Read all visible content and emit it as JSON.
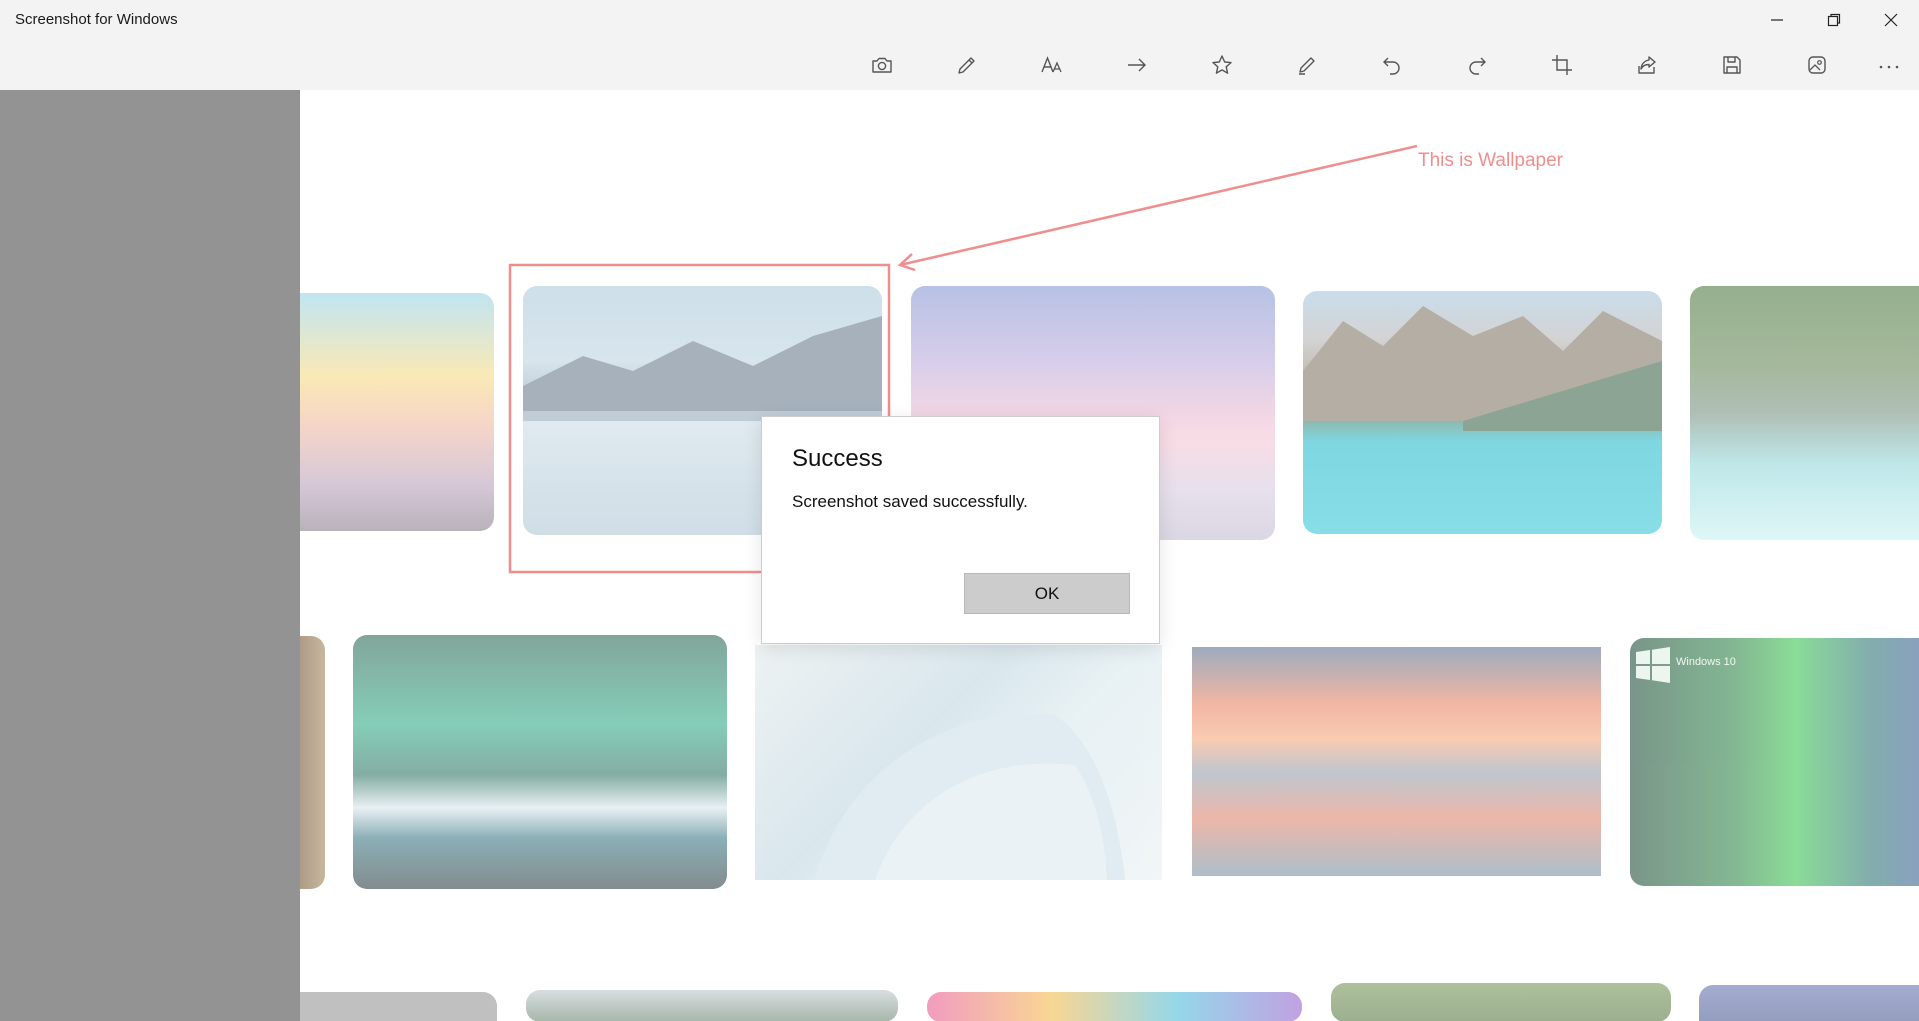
{
  "window": {
    "title": "Screenshot for Windows",
    "controls": [
      "minimize-icon",
      "restore-icon",
      "close-icon"
    ]
  },
  "toolbar": {
    "tools": [
      {
        "name": "camera-icon"
      },
      {
        "name": "pen-icon"
      },
      {
        "name": "text-size-icon"
      },
      {
        "name": "arrow-right-icon"
      },
      {
        "name": "star-icon"
      },
      {
        "name": "highlighter-icon"
      },
      {
        "name": "undo-icon"
      },
      {
        "name": "redo-icon"
      },
      {
        "name": "crop-icon"
      },
      {
        "name": "share-icon"
      },
      {
        "name": "save-icon"
      },
      {
        "name": "image-icon"
      },
      {
        "name": "more-icon"
      }
    ]
  },
  "annotation": {
    "label": "This is Wallpaper",
    "color": "#f08e8e"
  },
  "thumbnails": {
    "small_text": "Windows 10"
  },
  "dialog": {
    "title": "Success",
    "message": "Screenshot saved successfully.",
    "ok_label": "OK"
  }
}
